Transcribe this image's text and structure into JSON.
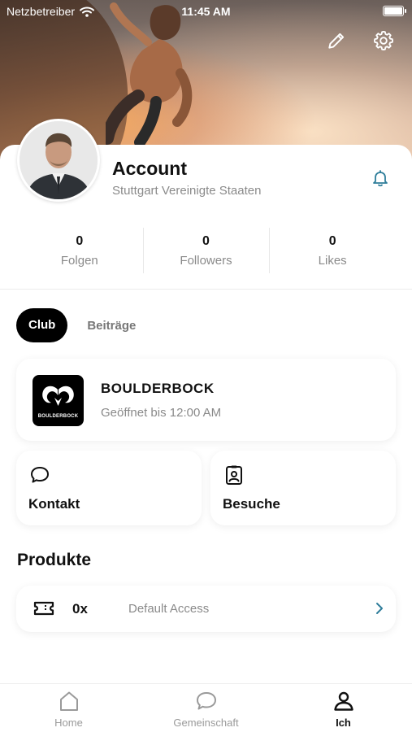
{
  "status_bar": {
    "carrier": "Netzbetreiber",
    "time": "11:45 AM",
    "battery_level": 1.0
  },
  "profile": {
    "name": "Account",
    "location": "Stuttgart Vereinigte Staaten"
  },
  "stats": [
    {
      "value": "0",
      "label": "Folgen"
    },
    {
      "value": "0",
      "label": "Followers"
    },
    {
      "value": "0",
      "label": "Likes"
    }
  ],
  "tabs": {
    "active": "Club",
    "other": "Beiträge"
  },
  "club": {
    "name": "BOULDERBOCK",
    "hours": "Geöffnet bis 12:00 AM",
    "logo_text": "BOULDERBOCK"
  },
  "actions": {
    "contact_label": "Kontakt",
    "visits_label": "Besuche"
  },
  "products": {
    "title": "Produkte",
    "items": [
      {
        "quantity": "0x",
        "name": "Default Access"
      }
    ]
  },
  "tabbar": {
    "items": [
      {
        "label": "Home",
        "icon": "home-icon"
      },
      {
        "label": "Gemeinschaft",
        "icon": "chat-bubble-icon"
      },
      {
        "label": "Ich",
        "icon": "person-icon"
      }
    ],
    "active": "Ich"
  },
  "colors": {
    "accent": "#2e7d9a",
    "black": "#000000",
    "muted": "#8a8a8a"
  }
}
